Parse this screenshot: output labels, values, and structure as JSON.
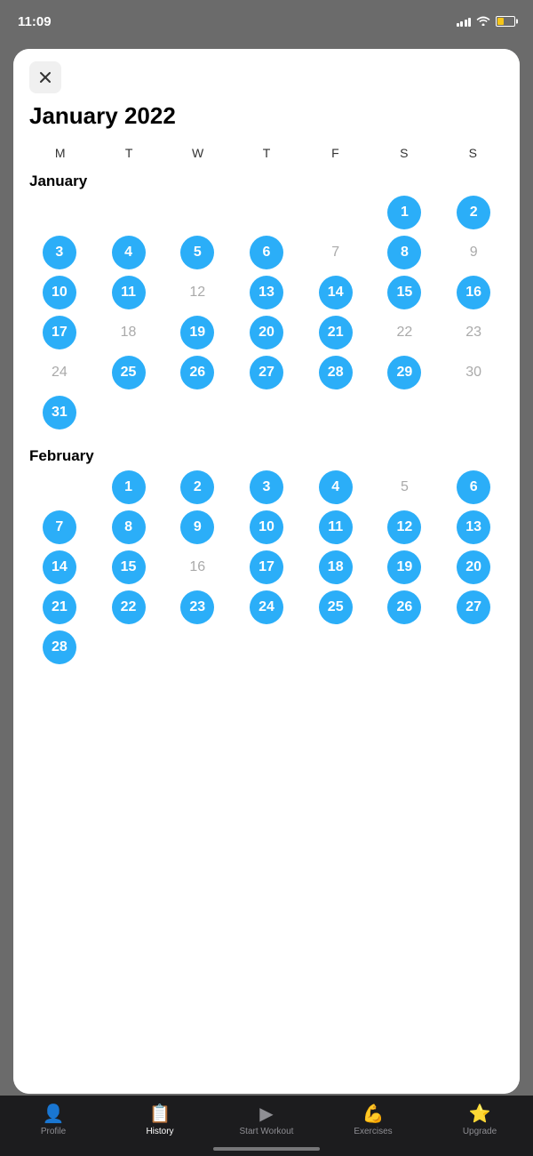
{
  "statusBar": {
    "time": "11:09"
  },
  "modal": {
    "title": "January 2022",
    "closeLabel": "✕"
  },
  "calendar": {
    "dayHeaders": [
      "M",
      "T",
      "W",
      "T",
      "F",
      "S",
      "S"
    ],
    "months": [
      {
        "name": "January",
        "startOffset": 5,
        "totalDays": 31,
        "activeDays": [
          1,
          2,
          3,
          4,
          5,
          6,
          8,
          10,
          11,
          13,
          14,
          15,
          16,
          17,
          19,
          20,
          21,
          25,
          26,
          27,
          28,
          29,
          31
        ],
        "inactiveDays": [
          7,
          9,
          12,
          18,
          22,
          23,
          24,
          30
        ]
      },
      {
        "name": "February",
        "startOffset": 1,
        "totalDays": 28,
        "activeDays": [
          1,
          2,
          3,
          4,
          6,
          7,
          8,
          9,
          10,
          11,
          12,
          13,
          14,
          15,
          17,
          18,
          19,
          20,
          21,
          22,
          23,
          24,
          25,
          26,
          27,
          28
        ],
        "inactiveDays": [
          5,
          16
        ],
        "partial": true
      }
    ]
  },
  "bottomNav": {
    "items": [
      {
        "id": "profile",
        "label": "Profile",
        "icon": "👤"
      },
      {
        "id": "history",
        "label": "History",
        "icon": "📋",
        "active": true
      },
      {
        "id": "start-workout",
        "label": "Start Workout",
        "icon": "▶"
      },
      {
        "id": "exercises",
        "label": "Exercises",
        "icon": "💪"
      },
      {
        "id": "upgrade",
        "label": "Upgrade",
        "icon": "⭐"
      }
    ]
  }
}
